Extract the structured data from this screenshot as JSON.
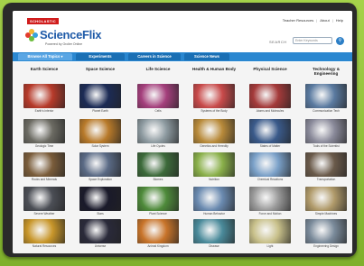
{
  "header": {
    "brand_badge": "SCHOLASTIC",
    "logo_title": "ScienceFlix",
    "logo_subtitle": "Powered by Grolier Online",
    "links": [
      "Teacher Resources",
      "About",
      "Help"
    ],
    "search_label": "SEARCH",
    "search_placeholder": "Enter Keywords"
  },
  "nav": {
    "tabs": [
      {
        "label": "Browse All Topics",
        "active": true
      },
      {
        "label": "Experiments",
        "active": false
      },
      {
        "label": "Careers in Science",
        "active": false
      },
      {
        "label": "Science News",
        "active": false
      }
    ]
  },
  "columns": [
    {
      "title": "Earth Science",
      "items": [
        "Earth's Interior",
        "Geologic Time",
        "Rocks and Minerals",
        "Severe Weather",
        "Natural Resources"
      ],
      "colors": [
        "#b63a2a",
        "#6b6a62",
        "#7a5c3a",
        "#4b4e55",
        "#c8962a"
      ]
    },
    {
      "title": "Space Science",
      "items": [
        "Planet Earth",
        "Solar System",
        "Space Exploration",
        "Stars",
        "Universe"
      ],
      "colors": [
        "#1c2b55",
        "#b87a2a",
        "#5a6a85",
        "#1a1a2a",
        "#2a2a3a"
      ]
    },
    {
      "title": "Life Science",
      "items": [
        "Cells",
        "Life Cycles",
        "Biomes",
        "Plant Science",
        "Animal Kingdom"
      ],
      "colors": [
        "#a43f7c",
        "#8d9aa0",
        "#3c6a3a",
        "#4e8a3a",
        "#c8742a"
      ]
    },
    {
      "title": "Health & Human Body",
      "items": [
        "Systems of the Body",
        "Genetics and Heredity",
        "Nutrition",
        "Human Behavior",
        "Disease"
      ],
      "colors": [
        "#c84a4a",
        "#b88a3a",
        "#8ab04a",
        "#6a8ab0",
        "#4a8a9a"
      ]
    },
    {
      "title": "Physical Science",
      "items": [
        "Atoms and Molecules",
        "States of Matter",
        "Chemical Reactions",
        "Force and Motion",
        "Light"
      ],
      "colors": [
        "#a43a3a",
        "#3a5a8a",
        "#7aa0c8",
        "#9a9a9a",
        "#c8c08a"
      ]
    },
    {
      "title": "Technology & Engineering",
      "items": [
        "Communication Tech",
        "Tools of the Scientist",
        "Transportation",
        "Simple Machines",
        "Engineering Design"
      ],
      "colors": [
        "#5a7aa0",
        "#8a8a9a",
        "#6a5a4a",
        "#b09a6a",
        "#7a8a9a"
      ]
    }
  ]
}
